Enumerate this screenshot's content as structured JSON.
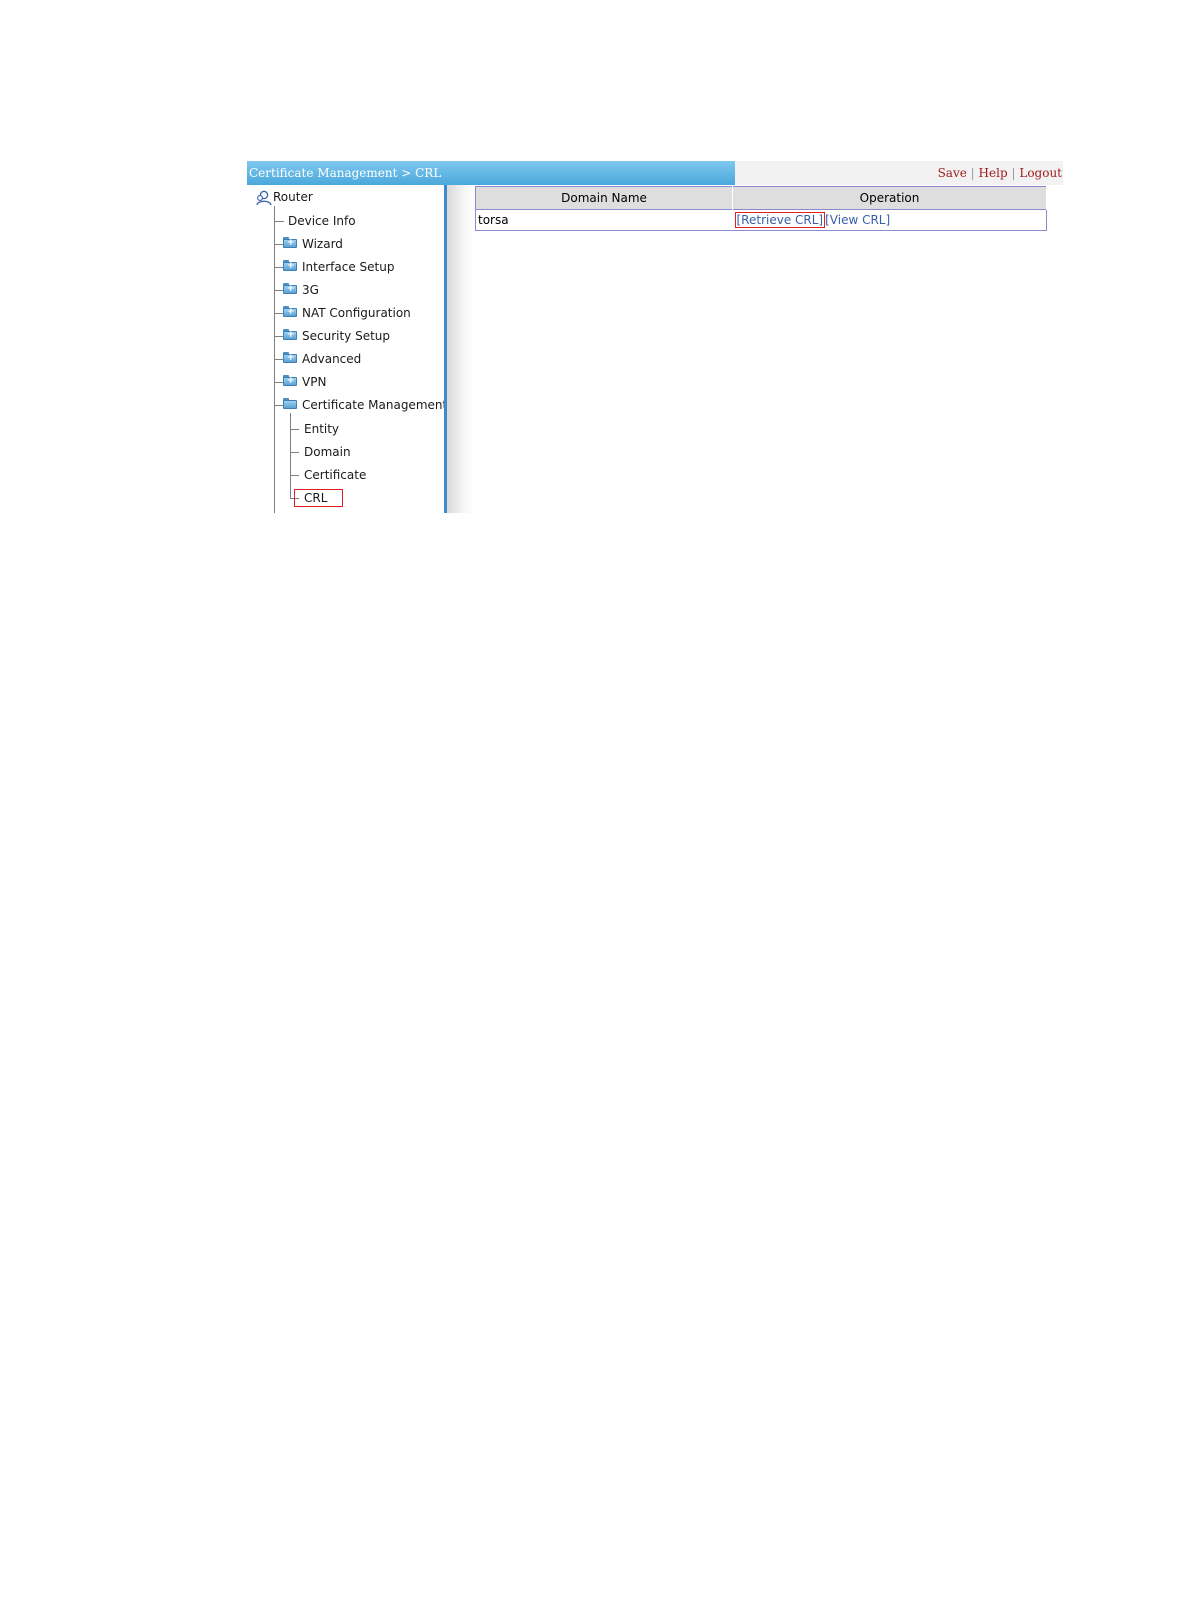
{
  "header": {
    "breadcrumb": "Certificate Management > CRL",
    "links": {
      "save": "Save",
      "help": "Help",
      "logout": "Logout",
      "separator": "|"
    }
  },
  "sidebar": {
    "root": "Router",
    "items": [
      {
        "label": "Device Info",
        "type": "leaf"
      },
      {
        "label": "Wizard",
        "type": "folder"
      },
      {
        "label": "Interface Setup",
        "type": "folder"
      },
      {
        "label": "3G",
        "type": "folder"
      },
      {
        "label": "NAT Configuration",
        "type": "folder"
      },
      {
        "label": "Security Setup",
        "type": "folder"
      },
      {
        "label": "Advanced",
        "type": "folder"
      },
      {
        "label": "VPN",
        "type": "folder"
      },
      {
        "label": "Certificate Management",
        "type": "folder-open"
      }
    ],
    "subitems": [
      {
        "label": "Entity"
      },
      {
        "label": "Domain"
      },
      {
        "label": "Certificate"
      },
      {
        "label": "CRL",
        "selected": true
      }
    ]
  },
  "table": {
    "columns": [
      "Domain Name",
      "Operation"
    ],
    "rows": [
      {
        "domain": "torsa",
        "retrieve": "[Retrieve CRL]",
        "view": "[View CRL]"
      }
    ]
  },
  "colors": {
    "accent": "#4aa8dc",
    "link": "#3a5fa8",
    "toplink": "#a01c1c",
    "highlight": "#e02020"
  }
}
